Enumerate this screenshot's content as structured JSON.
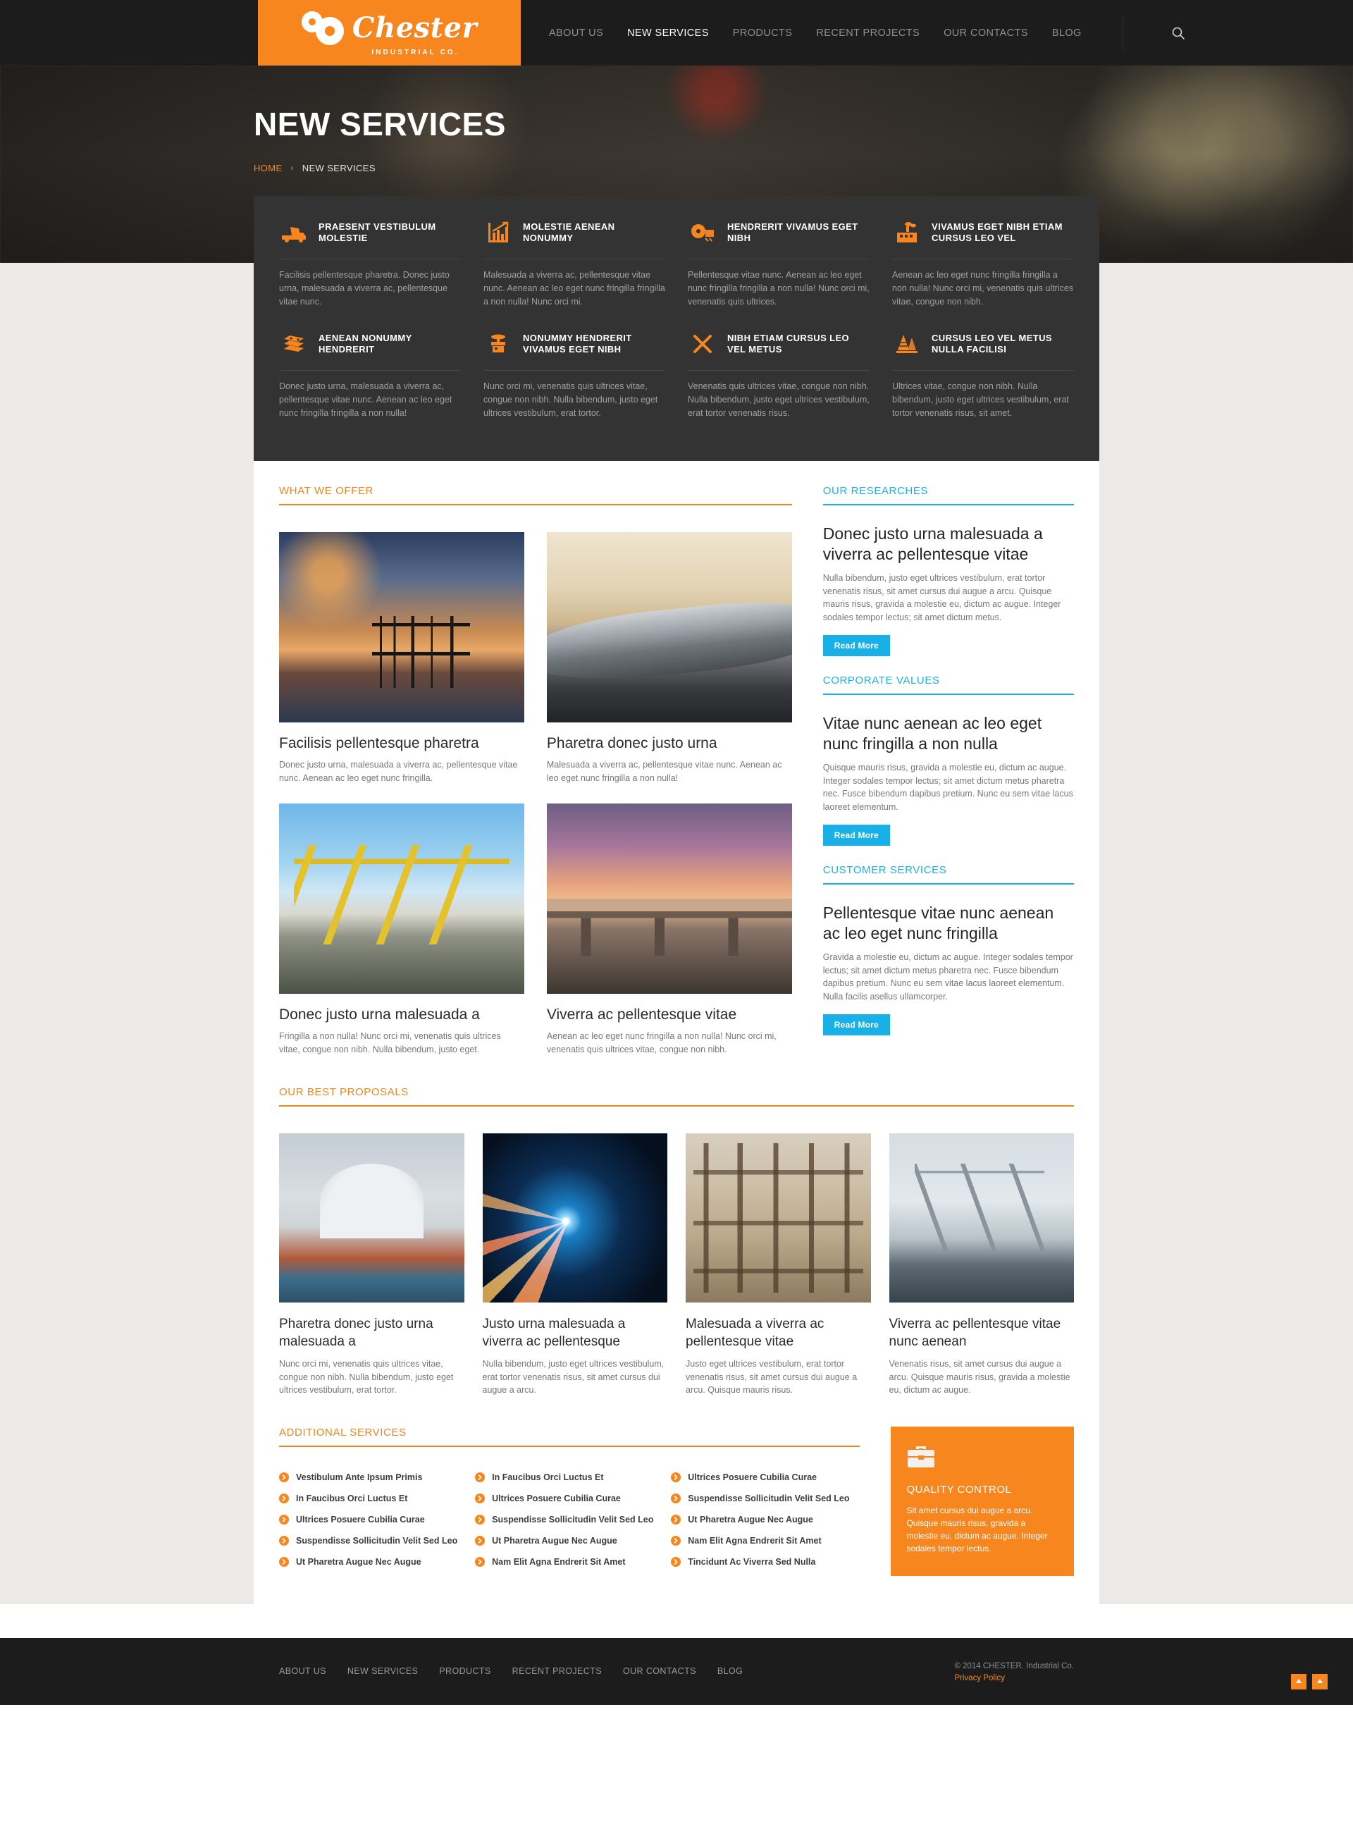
{
  "brand": {
    "name": "Chester",
    "tagline": "INDUSTRIAL CO.",
    "accent_orange": "#f7861f",
    "accent_blue": "#19b0e8",
    "dark": "#1c1c1c"
  },
  "nav": {
    "items": [
      {
        "label": "ABOUT US",
        "active": false
      },
      {
        "label": "NEW SERVICES",
        "active": true
      },
      {
        "label": "PRODUCTS",
        "active": false
      },
      {
        "label": "RECENT PROJECTS",
        "active": false
      },
      {
        "label": "OUR CONTACTS",
        "active": false
      },
      {
        "label": "BLOG",
        "active": false
      }
    ],
    "search_icon": "search-icon"
  },
  "hero": {
    "title": "NEW SERVICES",
    "breadcrumb": {
      "home": "HOME",
      "separator": "›",
      "current": "NEW SERVICES"
    }
  },
  "services_panel": [
    {
      "icon": "dump-truck-icon",
      "title": "PRAESENT VESTIBULUM MOLESTIE",
      "text": "Facilisis pellentesque pharetra. Donec justo urna, malesuada a viverra ac, pellentesque vitae nunc."
    },
    {
      "icon": "bar-chart-icon",
      "title": "MOLESTIE AENEAN NONUMMY",
      "text": "Malesuada a viverra ac, pellentesque vitae nunc. Aenean ac leo eget nunc fringilla fringilla a non nulla! Nunc orci mi."
    },
    {
      "icon": "saw-blade-icon",
      "title": "HENDRERIT VIVAMUS EGET NIBH",
      "text": "Pellentesque vitae nunc. Aenean ac leo eget nunc fringilla fringilla a non nulla! Nunc orci mi, venenatis quis ultrices."
    },
    {
      "icon": "factory-icon",
      "title": "VIVAMUS EGET NIBH ETIAM CURSUS LEO VEL",
      "text": "Aenean ac leo eget nunc fringilla fringilla a non nulla! Nunc orci mi, venenatis quis ultrices vitae, congue non nibh."
    },
    {
      "icon": "bricks-icon",
      "title": "AENEAN NONUMMY HENDRERIT",
      "text": "Donec justo urna, malesuada a viverra ac, pellentesque vitae nunc. Aenean ac leo eget nunc fringilla fringilla a non nulla!"
    },
    {
      "icon": "valve-icon",
      "title": "NONUMMY HENDRERIT VIVAMUS EGET NIBH",
      "text": "Nunc orci mi, venenatis quis ultrices vitae, congue non nibh. Nulla bibendum, justo eget ultrices vestibulum, erat tortor."
    },
    {
      "icon": "tools-icon",
      "title": "NIBH ETIAM CURSUS LEO VEL METUS",
      "text": "Venenatis quis ultrices vitae, congue non nibh. Nulla bibendum, justo eget ultrices vestibulum, erat tortor venenatis risus."
    },
    {
      "icon": "traffic-cone-icon",
      "title": "CURSUS LEO VEL METUS NULLA FACILISI",
      "text": "Ultrices vitae, congue non nibh. Nulla bibendum, justo eget ultrices vestibulum, erat tortor venenatis risus, sit amet."
    }
  ],
  "what_we_offer": {
    "section_title": "WHAT WE OFFER",
    "cards": [
      {
        "photo": "oil-rig-sunset-photo",
        "title": "Facilisis pellentesque pharetra",
        "text": "Donec justo urna, malesuada a viverra ac, pellentesque vitae nunc. Aenean ac leo eget nunc fringilla."
      },
      {
        "photo": "pipeline-photo",
        "title": "Pharetra donec justo urna",
        "text": "Malesuada a viverra ac, pellentesque vitae nunc. Aenean ac leo eget nunc fringilla a non nulla!"
      },
      {
        "photo": "port-cranes-photo",
        "title": "Donec justo urna malesuada a",
        "text": "Fringilla a non nulla! Nunc orci mi, venenatis quis ultrices vitae, congue non nibh. Nulla bibendum, justo eget."
      },
      {
        "photo": "bridge-construction-photo",
        "title": "Viverra ac pellentesque vitae",
        "text": "Aenean ac leo eget nunc fringilla a non nulla! Nunc orci mi, venenatis quis ultrices vitae, congue non nibh."
      }
    ]
  },
  "sidebar": {
    "blocks": [
      {
        "section_title": "OUR RESEARCHES",
        "heading": "Donec justo urna malesuada a viverra ac pellentesque vitae",
        "text": "Nulla bibendum, justo eget ultrices vestibulum, erat tortor venenatis risus, sit amet cursus dui augue a arcu. Quisque mauris risus, gravida a molestie eu, dictum ac augue. Integer sodales tempor lectus; sit amet dictum metus.",
        "button": "Read More"
      },
      {
        "section_title": "CORPORATE VALUES",
        "heading": "Vitae nunc aenean ac leo eget nunc fringilla a non nulla",
        "text": "Quisque mauris risus, gravida a molestie eu, dictum ac augue. Integer sodales tempor lectus; sit amet dictum metus pharetra nec. Fusce bibendum dapibus pretium. Nunc eu sem vitae lacus laoreet elementum.",
        "button": "Read More"
      },
      {
        "section_title": "CUSTOMER SERVICES",
        "heading": "Pellentesque vitae nunc aenean ac leo eget nunc fringilla",
        "text": "Gravida a molestie eu, dictum ac augue. Integer sodales tempor lectus; sit amet dictum metus pharetra nec. Fusce bibendum dapibus pretium. Nunc eu sem vitae lacus laoreet elementum. Nulla facilis asellus ullamcorper.",
        "button": "Read More"
      }
    ]
  },
  "proposals": {
    "section_title": "OUR BEST PROPOSALS",
    "cards": [
      {
        "photo": "storage-tank-photo",
        "title": "Pharetra donec justo urna malesuada a",
        "text": "Nunc orci mi, venenatis quis ultrices vitae, congue non nibh. Nulla bibendum, justo eget ultrices vestibulum, erat tortor."
      },
      {
        "photo": "welding-sparks-photo",
        "title": "Justo urna malesuada a viverra ac pellentesque",
        "text": "Nulla bibendum, justo eget ultrices vestibulum, erat tortor venenatis risus, sit amet cursus dui augue a arcu."
      },
      {
        "photo": "building-site-photo",
        "title": "Malesuada a viverra ac pellentesque vitae",
        "text": "Justo eget ultrices vestibulum, erat tortor venenatis risus, sit amet cursus dui augue a arcu. Quisque mauris risus."
      },
      {
        "photo": "cargo-ship-crane-photo",
        "title": "Viverra ac pellentesque vitae nunc aenean",
        "text": "Venenatis risus, sit amet cursus dui augue a arcu. Quisque mauris risus, gravida a molestie eu, dictum ac augue."
      }
    ]
  },
  "additional_services": {
    "section_title": "ADDITIONAL SERVICES",
    "columns": [
      [
        "Vestibulum Ante Ipsum Primis",
        "In Faucibus Orci Luctus Et",
        "Ultrices Posuere Cubilia Curae",
        "Suspendisse Sollicitudin Velit Sed Leo",
        "Ut Pharetra Augue Nec Augue"
      ],
      [
        "In Faucibus Orci Luctus Et",
        "Ultrices Posuere Cubilia Curae",
        "Suspendisse Sollicitudin Velit Sed Leo",
        "Ut Pharetra Augue Nec Augue",
        "Nam Elit Agna Endrerit Sit Amet"
      ],
      [
        "Ultrices Posuere Cubilia Curae",
        "Suspendisse Sollicitudin Velit Sed Leo",
        "Ut Pharetra Augue Nec Augue",
        "Nam Elit Agna Endrerit Sit Amet",
        "Tincidunt Ac Viverra Sed Nulla"
      ]
    ]
  },
  "quality_control": {
    "icon": "toolbox-icon",
    "title": "QUALITY CONTROL",
    "text": "Sit amet cursus dui augue a arcu. Quisque mauris risus, gravida a molestie eu, dictum ac augue. Integer sodales tempor lectus."
  },
  "footer": {
    "nav": [
      "ABOUT US",
      "NEW SERVICES",
      "PRODUCTS",
      "RECENT PROJECTS",
      "OUR CONTACTS",
      "BLOG"
    ],
    "copyright": "© 2014 CHESTER. Industrial Co.",
    "privacy": "Privacy Policy",
    "to_top_icon": "arrow-up-icon"
  }
}
